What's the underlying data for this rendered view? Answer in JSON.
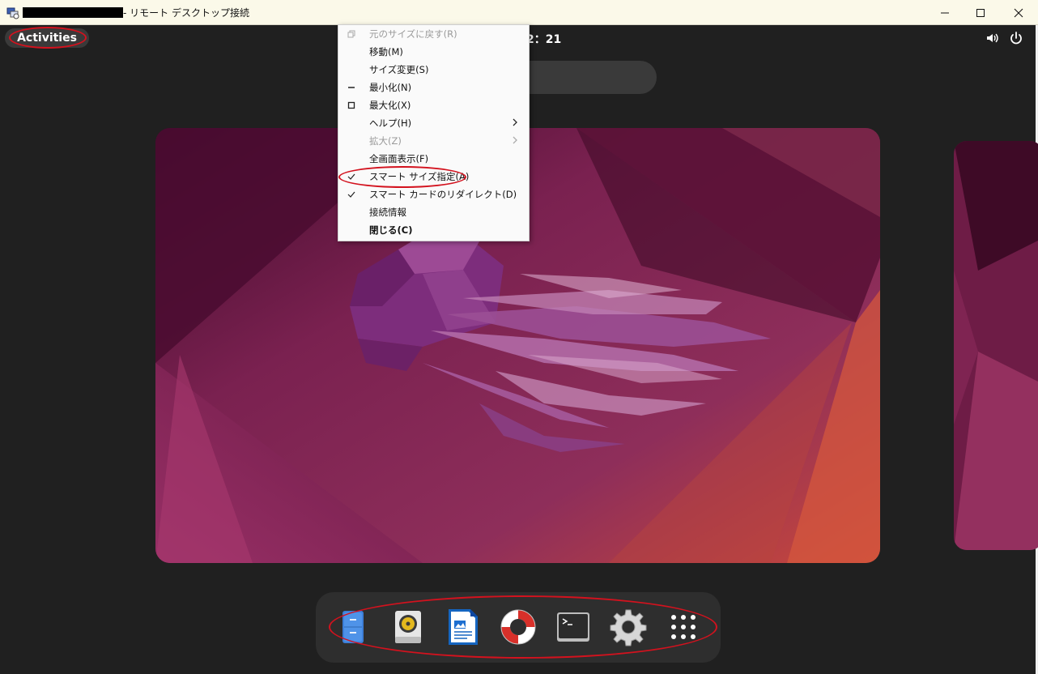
{
  "window": {
    "title": "- リモート デスクトップ接続",
    "minimize_label": "—",
    "maximize_label": "☐",
    "close_label": "✕"
  },
  "topbar": {
    "activities_label": "Activities",
    "clock": "2：21",
    "volume_icon": "volume-icon",
    "power_icon": "power-icon"
  },
  "system_menu": {
    "items": [
      {
        "label": "元のサイズに戻す(R)",
        "icon": "restore-icon",
        "enabled": false
      },
      {
        "label": "移動(M)",
        "enabled": true
      },
      {
        "label": "サイズ変更(S)",
        "enabled": true
      },
      {
        "label": "最小化(N)",
        "icon": "minimize-icon",
        "enabled": true
      },
      {
        "label": "最大化(X)",
        "icon": "maximize-icon",
        "enabled": true
      },
      {
        "label": "ヘルプ(H)",
        "submenu": true,
        "enabled": true
      },
      {
        "label": "拡大(Z)",
        "submenu": true,
        "enabled": false
      },
      {
        "label": "全画面表示(F)",
        "enabled": true
      },
      {
        "label": "スマート サイズ指定(A)",
        "checked": true,
        "enabled": true
      },
      {
        "label": "スマート カードのリダイレクト(D)",
        "checked": true,
        "enabled": true
      },
      {
        "label": "接続情報",
        "enabled": true
      },
      {
        "label": "閉じる(C)",
        "enabled": true,
        "bold": true
      }
    ]
  },
  "dock": {
    "items": [
      {
        "name": "files-icon"
      },
      {
        "name": "rhythmbox-icon"
      },
      {
        "name": "libreoffice-writer-icon"
      },
      {
        "name": "help-icon"
      },
      {
        "name": "terminal-icon"
      },
      {
        "name": "settings-icon"
      },
      {
        "name": "show-apps-icon"
      }
    ]
  },
  "colors": {
    "annotation": "#d3121e",
    "titlebar_bg": "#fbf9e9",
    "desktop_bg": "#202020",
    "wallpaper_primary": "#8a2a5e",
    "wallpaper_accent": "#c9483a"
  }
}
